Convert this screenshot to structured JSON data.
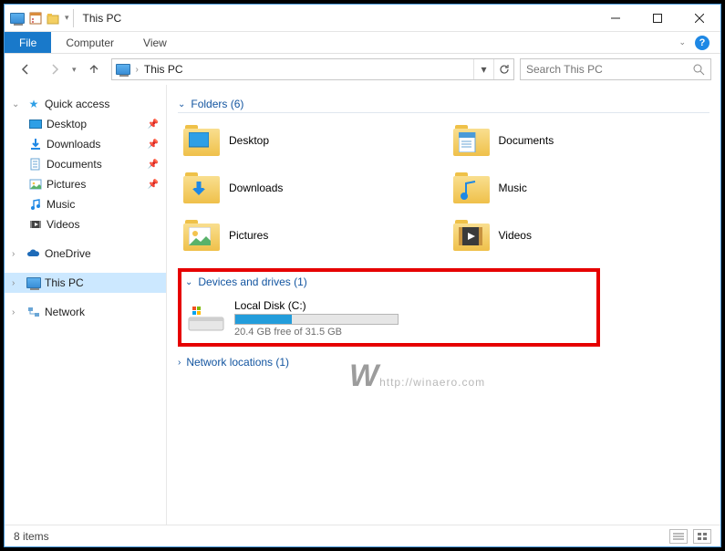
{
  "titlebar": {
    "title": "This PC"
  },
  "ribbon": {
    "file": "File",
    "tabs": [
      "Computer",
      "View"
    ]
  },
  "nav": {
    "address": "This PC",
    "search_placeholder": "Search This PC"
  },
  "sidebar": {
    "quick_access": "Quick access",
    "quick_items": [
      {
        "label": "Desktop",
        "icon": "desktop"
      },
      {
        "label": "Downloads",
        "icon": "downloads"
      },
      {
        "label": "Documents",
        "icon": "documents"
      },
      {
        "label": "Pictures",
        "icon": "pictures"
      },
      {
        "label": "Music",
        "icon": "music"
      },
      {
        "label": "Videos",
        "icon": "videos"
      }
    ],
    "onedrive": "OneDrive",
    "this_pc": "This PC",
    "network": "Network"
  },
  "content": {
    "folders_header": "Folders (6)",
    "folders": [
      {
        "label": "Desktop",
        "icon": "desktop"
      },
      {
        "label": "Documents",
        "icon": "documents"
      },
      {
        "label": "Downloads",
        "icon": "downloads"
      },
      {
        "label": "Music",
        "icon": "music"
      },
      {
        "label": "Pictures",
        "icon": "pictures"
      },
      {
        "label": "Videos",
        "icon": "videos"
      }
    ],
    "drives_header": "Devices and drives (1)",
    "drive": {
      "label": "Local Disk (C:)",
      "subtext": "20.4 GB free of 31.5 GB",
      "used_percent": 35
    },
    "network_header": "Network locations (1)"
  },
  "statusbar": {
    "count": "8 items"
  },
  "watermark": "http://winaero.com"
}
